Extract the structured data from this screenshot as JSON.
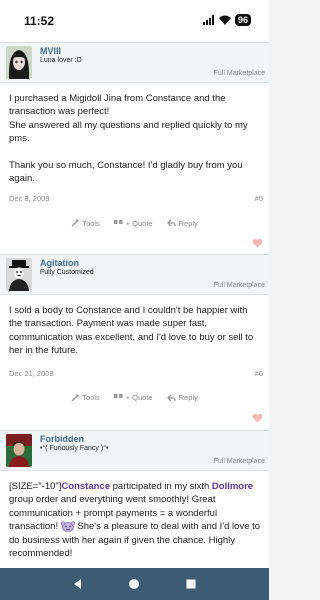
{
  "status": {
    "time": "11:52",
    "battery": "96"
  },
  "posts": [
    {
      "username": "MVIII",
      "usertitle": "Luna lover :D",
      "forum": "Full Marketplace",
      "paragraphs": [
        "I purchased a Migidoll Jina from Constance and the transaction was perfect!",
        "She answered all my questions and replied quickly to my pms.",
        "Thank you so much, Constance! I'd gladly buy from you again."
      ],
      "date": "Dec 8, 2008",
      "number": "#5"
    },
    {
      "username": "Agitation",
      "usertitle": "Fully Customized",
      "forum": "Full Marketplace",
      "paragraphs": [
        "I sold a body to Constance and I couldn't be happier with the transaction. Payment was made super fast, communication was excellent, and I'd love to buy or sell to her in the future."
      ],
      "date": "Dec 21, 2008",
      "number": "#6"
    },
    {
      "username": "Forbidden",
      "usertitle": "•°( Furiously Fancy )°•",
      "forum": "Full Marketplace",
      "text_prefix": "[SIZE=\"-10\"]",
      "link_constance": "Constance",
      "text_mid1": " participated in my sixth ",
      "link_dollmore": "Dollmore",
      "text_mid2": " group order and everything went smoothly! Great communication + prompt payments = a wonderful transaction! ",
      "text_end": " She's a pleasure to deal with and I'd love to do business with her again if given the chance. Highly recommended!"
    }
  ],
  "actions": {
    "tools": "Tools",
    "quote": "+ Quote",
    "reply": "Reply"
  },
  "colors": {
    "link": "#3d6b96",
    "purple": "#5a37a0",
    "nav": "#3c5b74",
    "heart": "#f7b8b8"
  },
  "icons": [
    "wifi-icon",
    "signal-icon",
    "wrench-icon",
    "quote-icon",
    "reply-icon",
    "heart-icon",
    "back-icon",
    "home-icon",
    "recents-icon"
  ]
}
